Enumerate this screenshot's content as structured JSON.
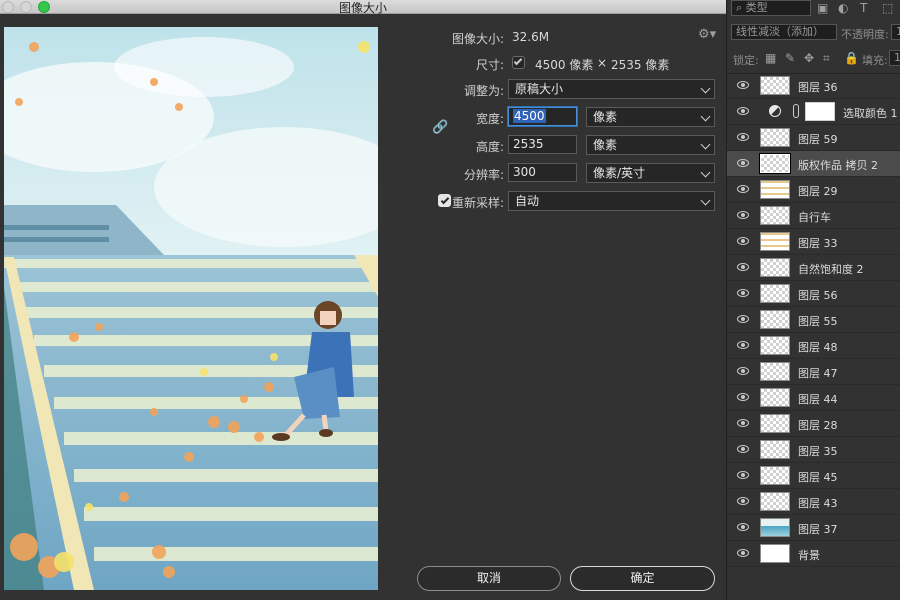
{
  "window": {
    "title": "图像大小"
  },
  "image_size": {
    "size_label": "图像大小:",
    "size_value": "32.6M",
    "dimensions_label": "尺寸:",
    "width_px": "4500 像素",
    "times": "×",
    "height_px": "2535 像素",
    "fit_label": "调整为:",
    "fit_value": "原稿大小",
    "width_label": "宽度:",
    "width_value": "4500",
    "width_unit": "像素",
    "height_label": "高度:",
    "height_value": "2535",
    "height_unit": "像素",
    "res_label": "分辨率:",
    "res_value": "300",
    "res_unit": "像素/英寸",
    "resample_label": "重新采样:",
    "resample_checked": true,
    "resample_value": "自动",
    "cancel": "取消",
    "ok": "确定"
  },
  "panel": {
    "filter_kind": "类型",
    "blend_mode": "线性减淡（添加）",
    "opacity_label": "不透明度:",
    "opacity_value": "1",
    "lock_label": "锁定:",
    "fill_label": "填充:",
    "fill_value": "1"
  },
  "layers": [
    {
      "name": "图层 36",
      "thumb": "checker"
    },
    {
      "name": "选取颜色 1",
      "thumb": "adjustment"
    },
    {
      "name": "图层 59",
      "thumb": "checker"
    },
    {
      "name": "版权作品 拷贝 2",
      "thumb": "checker",
      "selected": true
    },
    {
      "name": "图层 29",
      "thumb": "warm"
    },
    {
      "name": "自行车",
      "thumb": "checker"
    },
    {
      "name": "图层 33",
      "thumb": "warm"
    },
    {
      "name": "自然饱和度 2",
      "thumb": "checker"
    },
    {
      "name": "图层 56",
      "thumb": "checker"
    },
    {
      "name": "图层 55",
      "thumb": "checker"
    },
    {
      "name": "图层 48",
      "thumb": "checker"
    },
    {
      "name": "图层 47",
      "thumb": "checker"
    },
    {
      "name": "图层 44",
      "thumb": "checker"
    },
    {
      "name": "图层 28",
      "thumb": "checker"
    },
    {
      "name": "图层 35",
      "thumb": "checker"
    },
    {
      "name": "图层 45",
      "thumb": "checker"
    },
    {
      "name": "图层 43",
      "thumb": "checker"
    },
    {
      "name": "图层 37",
      "thumb": "sky"
    },
    {
      "name": "背景",
      "thumb": "white"
    }
  ],
  "colors": {
    "accent": "#4a90d9",
    "selected_row": "#4b4b4b"
  }
}
